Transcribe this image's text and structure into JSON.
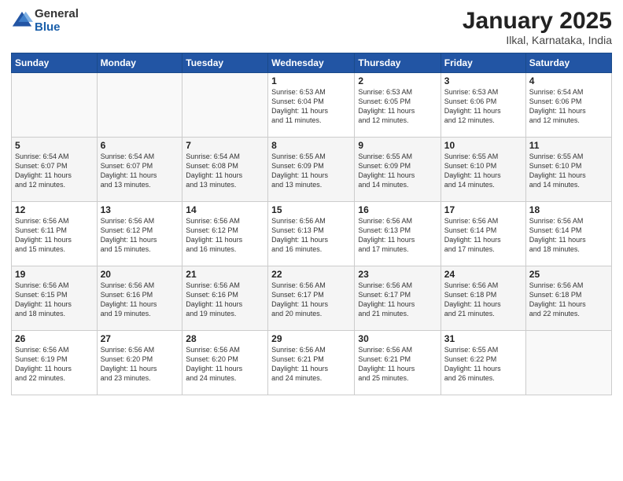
{
  "header": {
    "logo_general": "General",
    "logo_blue": "Blue",
    "title": "January 2025",
    "subtitle": "Ilkal, Karnataka, India"
  },
  "days_of_week": [
    "Sunday",
    "Monday",
    "Tuesday",
    "Wednesday",
    "Thursday",
    "Friday",
    "Saturday"
  ],
  "weeks": [
    [
      {
        "day": "",
        "info": ""
      },
      {
        "day": "",
        "info": ""
      },
      {
        "day": "",
        "info": ""
      },
      {
        "day": "1",
        "info": "Sunrise: 6:53 AM\nSunset: 6:04 PM\nDaylight: 11 hours\nand 11 minutes."
      },
      {
        "day": "2",
        "info": "Sunrise: 6:53 AM\nSunset: 6:05 PM\nDaylight: 11 hours\nand 12 minutes."
      },
      {
        "day": "3",
        "info": "Sunrise: 6:53 AM\nSunset: 6:06 PM\nDaylight: 11 hours\nand 12 minutes."
      },
      {
        "day": "4",
        "info": "Sunrise: 6:54 AM\nSunset: 6:06 PM\nDaylight: 11 hours\nand 12 minutes."
      }
    ],
    [
      {
        "day": "5",
        "info": "Sunrise: 6:54 AM\nSunset: 6:07 PM\nDaylight: 11 hours\nand 12 minutes."
      },
      {
        "day": "6",
        "info": "Sunrise: 6:54 AM\nSunset: 6:07 PM\nDaylight: 11 hours\nand 13 minutes."
      },
      {
        "day": "7",
        "info": "Sunrise: 6:54 AM\nSunset: 6:08 PM\nDaylight: 11 hours\nand 13 minutes."
      },
      {
        "day": "8",
        "info": "Sunrise: 6:55 AM\nSunset: 6:09 PM\nDaylight: 11 hours\nand 13 minutes."
      },
      {
        "day": "9",
        "info": "Sunrise: 6:55 AM\nSunset: 6:09 PM\nDaylight: 11 hours\nand 14 minutes."
      },
      {
        "day": "10",
        "info": "Sunrise: 6:55 AM\nSunset: 6:10 PM\nDaylight: 11 hours\nand 14 minutes."
      },
      {
        "day": "11",
        "info": "Sunrise: 6:55 AM\nSunset: 6:10 PM\nDaylight: 11 hours\nand 14 minutes."
      }
    ],
    [
      {
        "day": "12",
        "info": "Sunrise: 6:56 AM\nSunset: 6:11 PM\nDaylight: 11 hours\nand 15 minutes."
      },
      {
        "day": "13",
        "info": "Sunrise: 6:56 AM\nSunset: 6:12 PM\nDaylight: 11 hours\nand 15 minutes."
      },
      {
        "day": "14",
        "info": "Sunrise: 6:56 AM\nSunset: 6:12 PM\nDaylight: 11 hours\nand 16 minutes."
      },
      {
        "day": "15",
        "info": "Sunrise: 6:56 AM\nSunset: 6:13 PM\nDaylight: 11 hours\nand 16 minutes."
      },
      {
        "day": "16",
        "info": "Sunrise: 6:56 AM\nSunset: 6:13 PM\nDaylight: 11 hours\nand 17 minutes."
      },
      {
        "day": "17",
        "info": "Sunrise: 6:56 AM\nSunset: 6:14 PM\nDaylight: 11 hours\nand 17 minutes."
      },
      {
        "day": "18",
        "info": "Sunrise: 6:56 AM\nSunset: 6:14 PM\nDaylight: 11 hours\nand 18 minutes."
      }
    ],
    [
      {
        "day": "19",
        "info": "Sunrise: 6:56 AM\nSunset: 6:15 PM\nDaylight: 11 hours\nand 18 minutes."
      },
      {
        "day": "20",
        "info": "Sunrise: 6:56 AM\nSunset: 6:16 PM\nDaylight: 11 hours\nand 19 minutes."
      },
      {
        "day": "21",
        "info": "Sunrise: 6:56 AM\nSunset: 6:16 PM\nDaylight: 11 hours\nand 19 minutes."
      },
      {
        "day": "22",
        "info": "Sunrise: 6:56 AM\nSunset: 6:17 PM\nDaylight: 11 hours\nand 20 minutes."
      },
      {
        "day": "23",
        "info": "Sunrise: 6:56 AM\nSunset: 6:17 PM\nDaylight: 11 hours\nand 21 minutes."
      },
      {
        "day": "24",
        "info": "Sunrise: 6:56 AM\nSunset: 6:18 PM\nDaylight: 11 hours\nand 21 minutes."
      },
      {
        "day": "25",
        "info": "Sunrise: 6:56 AM\nSunset: 6:18 PM\nDaylight: 11 hours\nand 22 minutes."
      }
    ],
    [
      {
        "day": "26",
        "info": "Sunrise: 6:56 AM\nSunset: 6:19 PM\nDaylight: 11 hours\nand 22 minutes."
      },
      {
        "day": "27",
        "info": "Sunrise: 6:56 AM\nSunset: 6:20 PM\nDaylight: 11 hours\nand 23 minutes."
      },
      {
        "day": "28",
        "info": "Sunrise: 6:56 AM\nSunset: 6:20 PM\nDaylight: 11 hours\nand 24 minutes."
      },
      {
        "day": "29",
        "info": "Sunrise: 6:56 AM\nSunset: 6:21 PM\nDaylight: 11 hours\nand 24 minutes."
      },
      {
        "day": "30",
        "info": "Sunrise: 6:56 AM\nSunset: 6:21 PM\nDaylight: 11 hours\nand 25 minutes."
      },
      {
        "day": "31",
        "info": "Sunrise: 6:55 AM\nSunset: 6:22 PM\nDaylight: 11 hours\nand 26 minutes."
      },
      {
        "day": "",
        "info": ""
      }
    ]
  ]
}
